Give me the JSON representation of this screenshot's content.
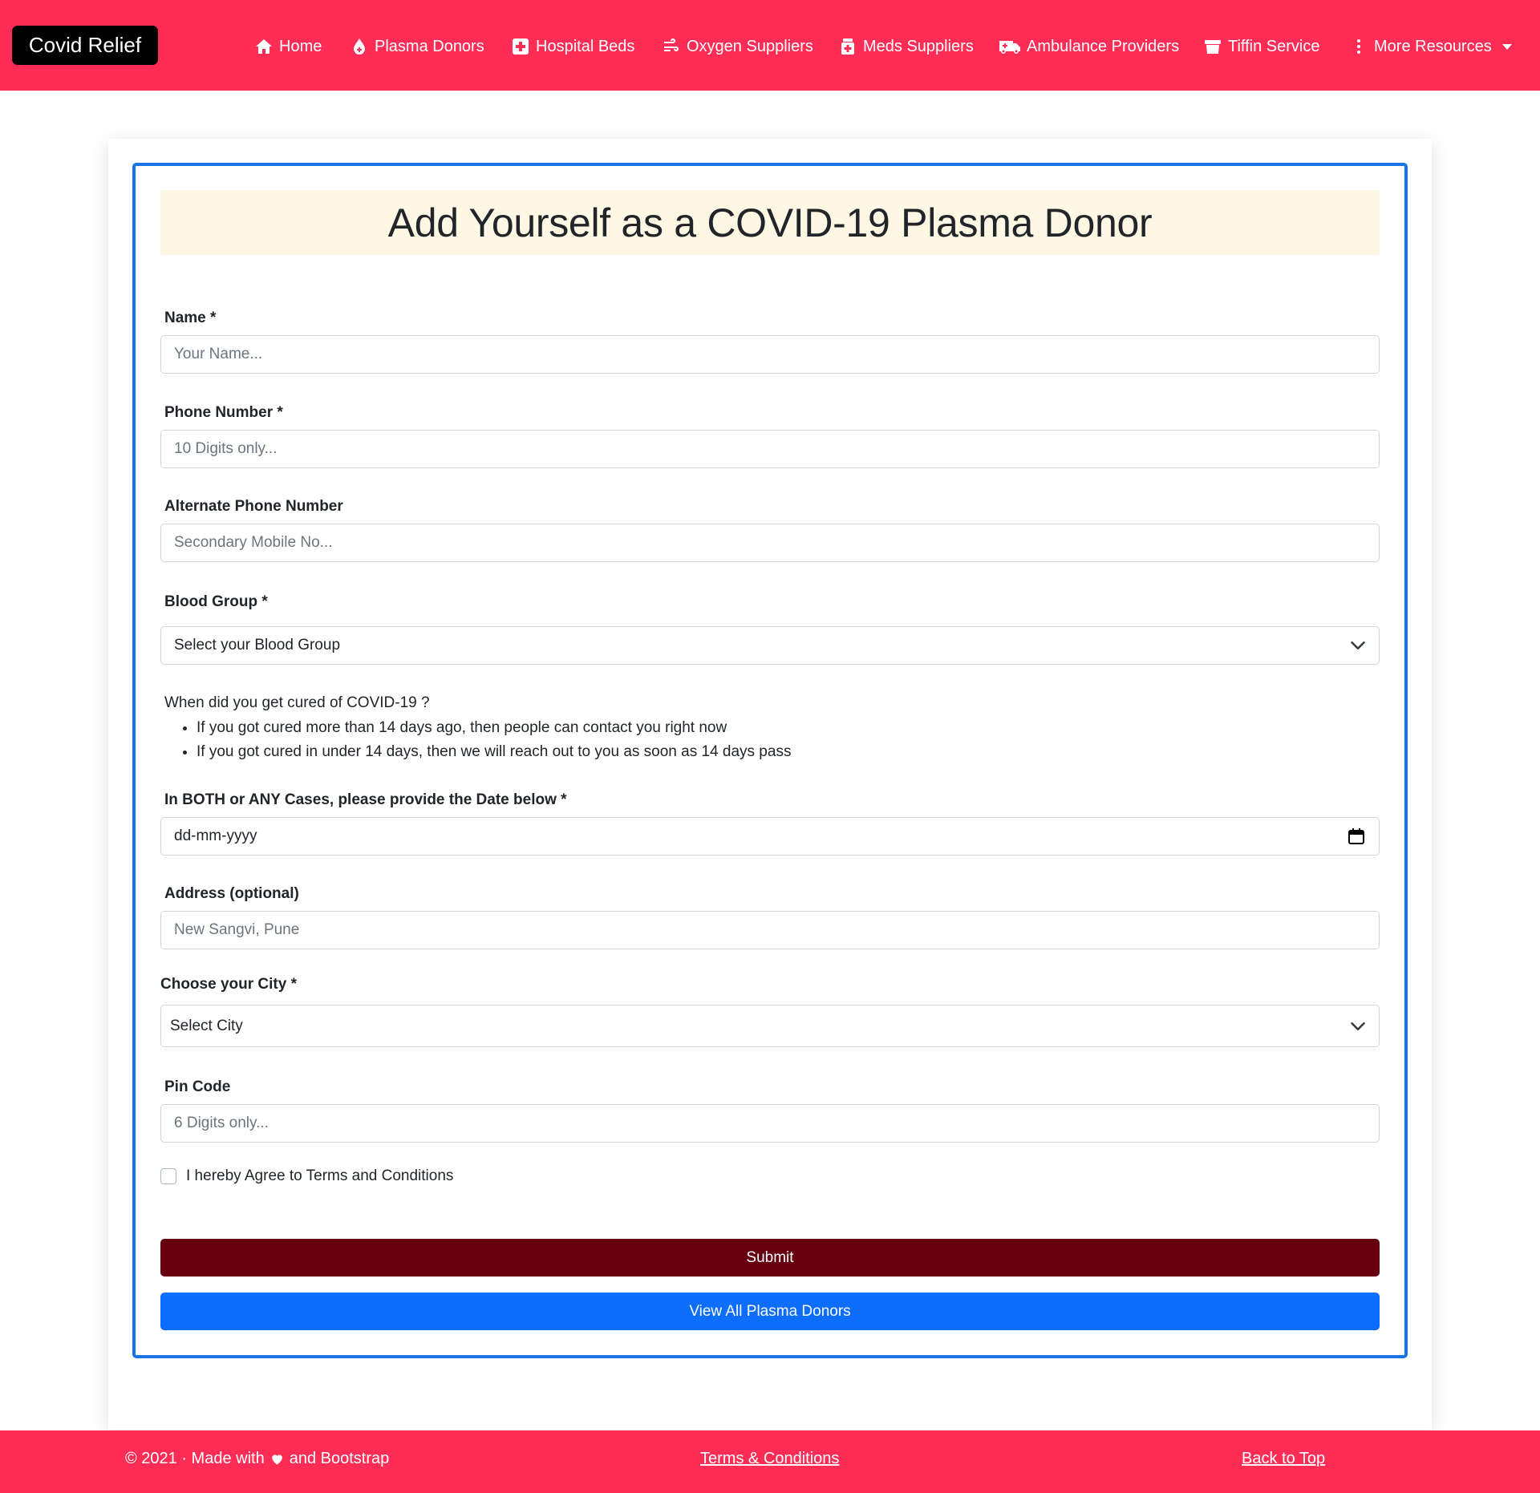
{
  "navbar": {
    "brand": "Covid Relief",
    "items": [
      {
        "label": "Home",
        "icon": "home-icon"
      },
      {
        "label": "Plasma Donors",
        "icon": "blood-drop-icon"
      },
      {
        "label": "Hospital Beds",
        "icon": "medical-cross-icon"
      },
      {
        "label": "Oxygen Suppliers",
        "icon": "wind-icon"
      },
      {
        "label": "Meds Suppliers",
        "icon": "medicine-bottle-icon"
      },
      {
        "label": "Ambulance Providers",
        "icon": "ambulance-icon"
      },
      {
        "label": "Tiffin Service",
        "icon": "tiffin-box-icon"
      },
      {
        "label": "More Resources",
        "icon": "vertical-dots-icon"
      }
    ]
  },
  "form": {
    "title": "Add Yourself as a COVID-19 Plasma Donor",
    "name": {
      "label": "Name *",
      "placeholder": "Your Name..."
    },
    "phone": {
      "label": "Phone Number *",
      "placeholder": "10 Digits only..."
    },
    "alt_phone": {
      "label": "Alternate Phone Number",
      "placeholder": "Secondary Mobile No..."
    },
    "blood_group": {
      "label": "Blood Group *",
      "selected": "Select your Blood Group"
    },
    "cure_info": {
      "question": "When did you get cured of COVID-19 ?",
      "points": [
        "If you got cured more than 14 days ago, then people can contact you right now",
        "If you got cured in under 14 days, then we will reach out to you as soon as 14 days pass"
      ]
    },
    "date": {
      "label": "In BOTH or ANY Cases, please provide the Date below *",
      "value": "dd-mm-yyyy"
    },
    "address": {
      "label": "Address (optional)",
      "placeholder": "New Sangvi, Pune"
    },
    "city": {
      "label": "Choose your City *",
      "selected": "Select City"
    },
    "pincode": {
      "label": "Pin Code",
      "placeholder": "6 Digits only..."
    },
    "terms_checkbox": "I hereby Agree to Terms and Conditions",
    "submit": "Submit",
    "view_all": "View All Plasma Donors"
  },
  "footer": {
    "copyright_before": "© 2021 · Made with",
    "copyright_after": "and Bootstrap",
    "terms": "Terms & Conditions",
    "back_to_top": "Back to Top"
  },
  "colors": {
    "navbar": "#ff2d55",
    "brand_bg": "#000000",
    "form_border": "#1a73e8",
    "title_bg": "#fdf7e4",
    "submit_bg": "#660011",
    "view_all_bg": "#0d6efd"
  }
}
